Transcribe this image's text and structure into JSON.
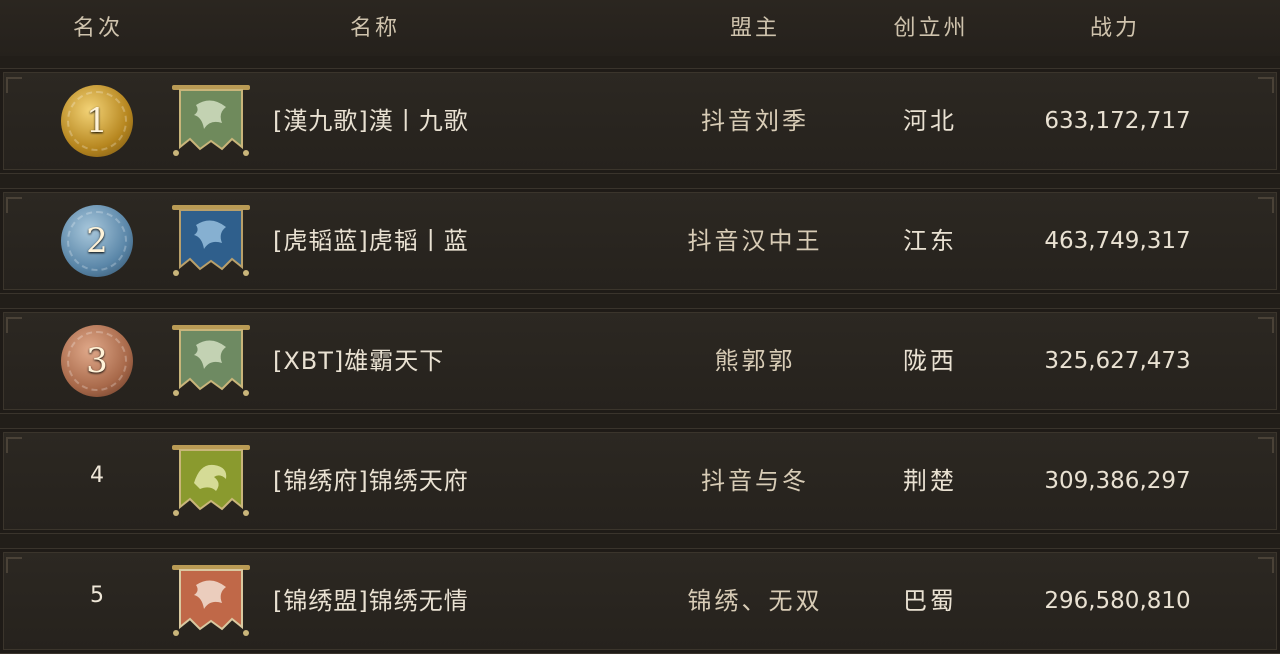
{
  "header": {
    "rank": "名次",
    "name": "名称",
    "leader": "盟主",
    "state": "创立州",
    "power": "战力"
  },
  "rows": [
    {
      "rank": "1",
      "medal_color": "#c99a2a",
      "banner_color": "#6f8a5c",
      "banner_icon": "dragon-banner-icon",
      "name": "[漢九歌]漢丨九歌",
      "leader": "抖音刘季",
      "state": "河北",
      "power": "633,172,717"
    },
    {
      "rank": "2",
      "medal_color": "#5a86a8",
      "banner_color": "#2f5f8c",
      "banner_icon": "dragon-banner-icon",
      "name": "[虎韬蓝]虎韬丨蓝",
      "leader": "抖音汉中王",
      "state": "江东",
      "power": "463,749,317"
    },
    {
      "rank": "3",
      "medal_color": "#a8694a",
      "banner_color": "#6e8a62",
      "banner_icon": "dragon-banner-icon",
      "name": "[XBT]雄霸天下",
      "leader": "熊郭郭",
      "state": "陇西",
      "power": "325,627,473"
    },
    {
      "rank": "4",
      "medal_color": "",
      "banner_color": "#8a9a2e",
      "banner_icon": "phoenix-banner-icon",
      "name": "[锦绣府]锦绣天府",
      "leader": "抖音与冬",
      "state": "荆楚",
      "power": "309,386,297"
    },
    {
      "rank": "5",
      "medal_color": "",
      "banner_color": "#c06848",
      "banner_icon": "dragon-banner-icon",
      "name": "[锦绣盟]锦绣无情",
      "leader": "锦绣、无双",
      "state": "巴蜀",
      "power": "296,580,810"
    }
  ]
}
